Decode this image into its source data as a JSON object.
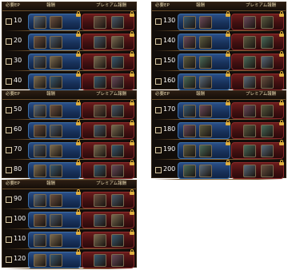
{
  "header": {
    "ep_label": "必要EP",
    "reward_label": "報酬",
    "premium_label": "プレミアム報酬"
  },
  "panels": [
    {
      "rows": [
        "10",
        "20",
        "30",
        "40"
      ]
    },
    {
      "rows": [
        "130",
        "140",
        "150",
        "160"
      ]
    },
    {
      "rows": [
        "50",
        "60",
        "70",
        "80"
      ]
    },
    {
      "rows": [
        "170",
        "180",
        "190",
        "200"
      ]
    },
    {
      "rows": [
        "90",
        "100",
        "110",
        "120"
      ]
    }
  ],
  "colors": {
    "free_row": "#1f3d6b",
    "premium_row": "#4a1213",
    "gold_trim": "#8a6a3a",
    "lock": "#e0b040"
  },
  "icons": {
    "checkbox": "checkbox-icon",
    "lock": "lock-icon"
  }
}
